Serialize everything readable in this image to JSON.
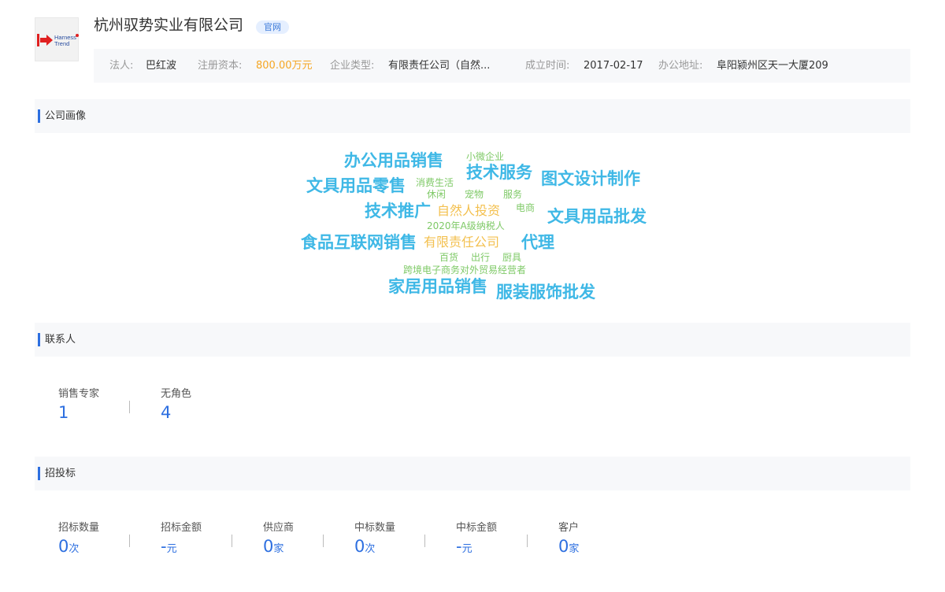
{
  "header": {
    "company_name": "杭州驭势实业有限公司",
    "badge": "官网",
    "logo_text": [
      "Harness",
      "Trend"
    ],
    "accent": "#2d6fe0"
  },
  "info": [
    {
      "label": "法人:",
      "value": "巴红波"
    },
    {
      "label": "注册资本:",
      "value": "800.00万元",
      "highlight": "#f5a623"
    },
    {
      "label": "企业类型:",
      "value": "有限责任公司（自然..."
    },
    {
      "label": "成立时间:",
      "value": "2017-02-17"
    },
    {
      "label": "办公地址:",
      "value": "阜阳颍州区天一大厦209"
    }
  ],
  "sections": {
    "profile": "公司画像",
    "contacts": "联系人",
    "bidding": "招投标"
  },
  "word_cloud": [
    {
      "text": "办公用品销售",
      "color": "#3fb8e6"
    },
    {
      "text": "小微企业",
      "color": "#7ec966"
    },
    {
      "text": "文具用品零售",
      "color": "#3fb8e6"
    },
    {
      "text": "消费生活",
      "color": "#7ec966"
    },
    {
      "text": "技术服务",
      "color": "#3fb8e6"
    },
    {
      "text": "图文设计制作",
      "color": "#3fb8e6"
    },
    {
      "text": "休闲",
      "color": "#7ec966"
    },
    {
      "text": "宠物",
      "color": "#7ec966"
    },
    {
      "text": "服务",
      "color": "#7ec966"
    },
    {
      "text": "技术推广",
      "color": "#3fb8e6"
    },
    {
      "text": "自然人投资",
      "color": "#f3c04f"
    },
    {
      "text": "电商",
      "color": "#7ec966"
    },
    {
      "text": "文具用品批发",
      "color": "#3fb8e6"
    },
    {
      "text": "2020年A级纳税人",
      "color": "#7ec966"
    },
    {
      "text": "食品互联网销售",
      "color": "#3fb8e6"
    },
    {
      "text": "有限责任公司",
      "color": "#f3c04f"
    },
    {
      "text": "代理",
      "color": "#3fb8e6"
    },
    {
      "text": "百货",
      "color": "#7ec966"
    },
    {
      "text": "出行",
      "color": "#7ec966"
    },
    {
      "text": "厨具",
      "color": "#7ec966"
    },
    {
      "text": "跨境电子商务对外贸易经营者",
      "color": "#7ec966"
    },
    {
      "text": "家居用品销售",
      "color": "#3fb8e6"
    },
    {
      "text": "服装服饰批发",
      "color": "#3fb8e6"
    }
  ],
  "contacts": [
    {
      "label": "销售专家",
      "value": "1"
    },
    {
      "label": "无角色",
      "value": "4"
    }
  ],
  "bidding": [
    {
      "label": "招标数量",
      "value": "0",
      "unit": "次"
    },
    {
      "label": "招标金额",
      "value": "-",
      "unit": "元"
    },
    {
      "label": "供应商",
      "value": "0",
      "unit": "家"
    },
    {
      "label": "中标数量",
      "value": "0",
      "unit": "次"
    },
    {
      "label": "中标金额",
      "value": "-",
      "unit": "元"
    },
    {
      "label": "客户",
      "value": "0",
      "unit": "家"
    }
  ]
}
